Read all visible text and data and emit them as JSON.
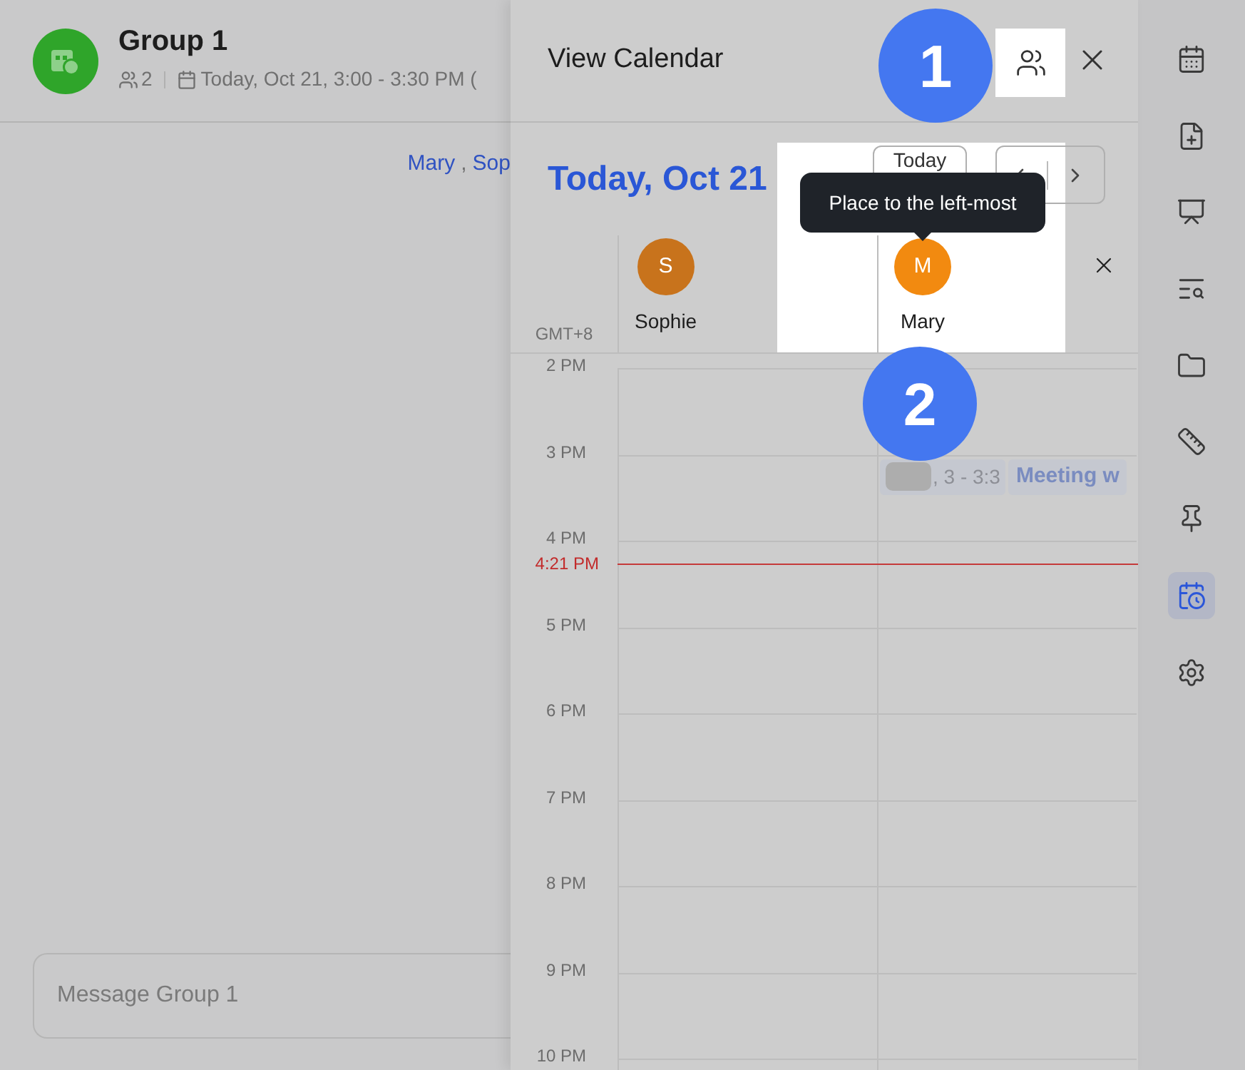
{
  "chat": {
    "title": "Group 1",
    "member_count": "2",
    "meeting_time": "Today, Oct 21, 3:00 - 3:30 PM (",
    "mentions": [
      "Mary",
      "Sop"
    ],
    "mention_separator": ",",
    "input": {
      "placeholder": "Message Group 1"
    }
  },
  "calendar": {
    "title": "View Calendar",
    "date": "Today, Oct 21",
    "today_button": "Today",
    "timezone": "GMT+8",
    "people": [
      {
        "initial": "S",
        "name": "Sophie",
        "color": "#c8731c"
      },
      {
        "initial": "M",
        "name": "Mary",
        "color": "#f28a10"
      }
    ],
    "hours": [
      "2 PM",
      "3 PM",
      "4 PM",
      "5 PM",
      "6 PM",
      "7 PM",
      "8 PM",
      "9 PM",
      "10 PM"
    ],
    "now": "4:21 PM",
    "event": {
      "time": ", 3 - 3:3",
      "title": "Meeting w"
    }
  },
  "guide": {
    "steps": [
      "1",
      "2"
    ],
    "tooltip": "Place to the left-most"
  },
  "sidebar": [
    {
      "kind": "calendar",
      "selected": false
    },
    {
      "kind": "new-doc",
      "selected": false
    },
    {
      "kind": "board",
      "selected": false
    },
    {
      "kind": "search-list",
      "selected": false
    },
    {
      "kind": "folder",
      "selected": false
    },
    {
      "kind": "ruler",
      "selected": false
    },
    {
      "kind": "pin",
      "selected": false
    },
    {
      "kind": "calendar-clock",
      "selected": true
    },
    {
      "kind": "settings",
      "selected": false
    }
  ]
}
